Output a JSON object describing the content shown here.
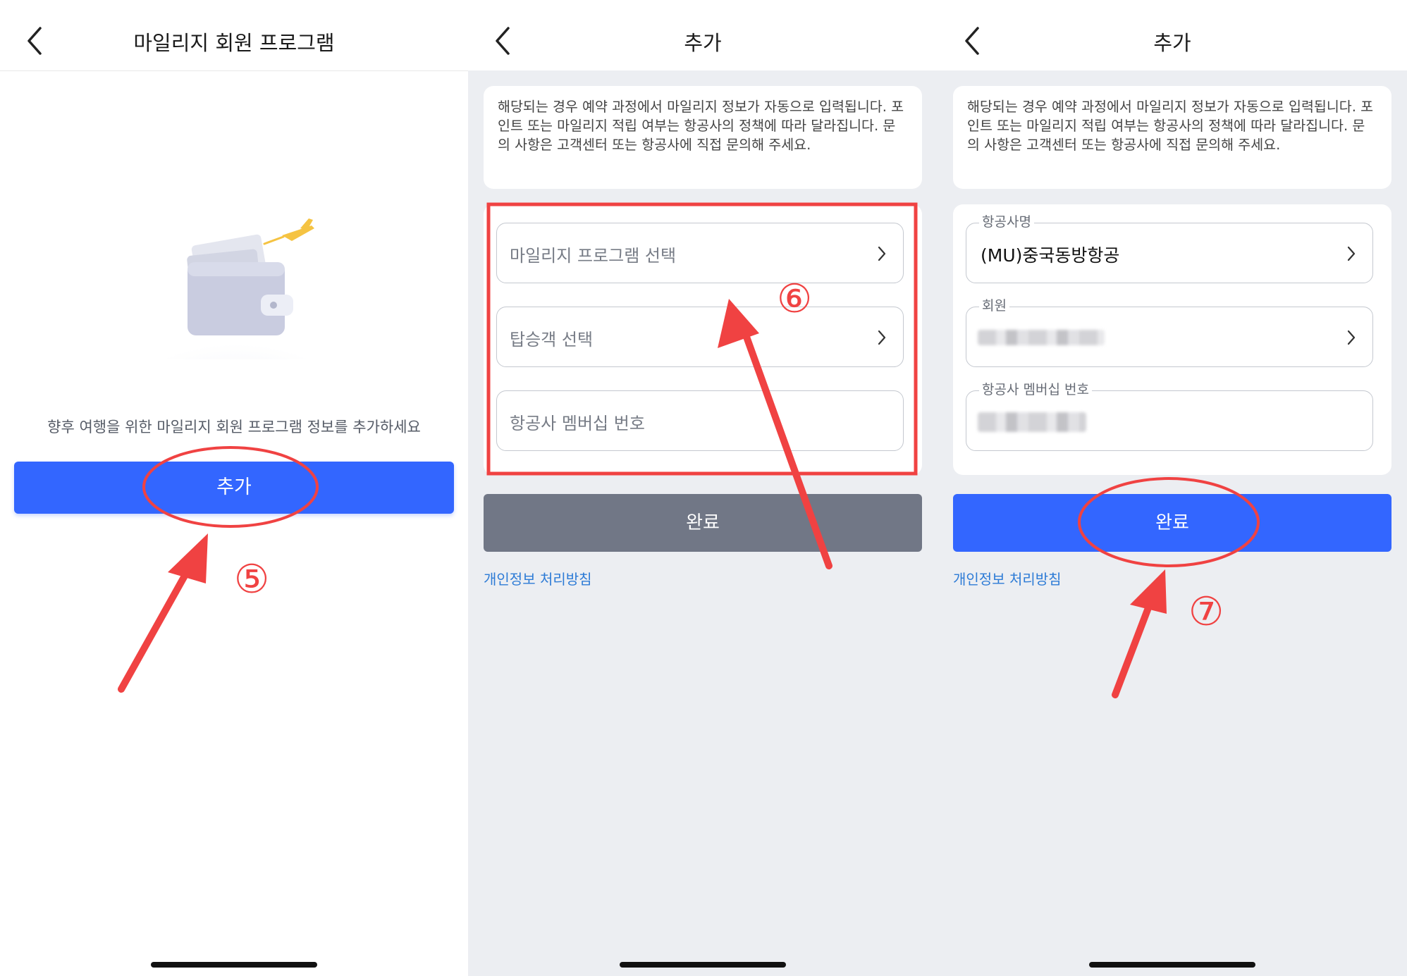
{
  "panel1": {
    "title": "마일리지 회원 프로그램",
    "empty_text": "향후 여행을 위한 마일리지 회원 프로그램 정보를 추가하세요",
    "add_button": "추가"
  },
  "panel2": {
    "title": "추가",
    "notice": "해당되는 경우 예약 과정에서 마일리지 정보가 자동으로 입력됩니다. 포인트 또는 마일리지 적립 여부는 항공사의 정책에 따라 달라집니다. 문의 사항은 고객센터 또는 항공사에 직접 문의해 주세요.",
    "fields": {
      "program_placeholder": "마일리지 프로그램 선택",
      "passenger_placeholder": "탑승객 선택",
      "membership_placeholder": "항공사 멤버십 번호"
    },
    "done_button": "완료",
    "privacy_link": "개인정보 처리방침"
  },
  "panel3": {
    "title": "추가",
    "notice": "해당되는 경우 예약 과정에서 마일리지 정보가 자동으로 입력됩니다. 포인트 또는 마일리지 적립 여부는 항공사의 정책에 따라 달라집니다. 문의 사항은 고객센터 또는 항공사에 직접 문의해 주세요.",
    "fields": {
      "airline_label": "항공사명",
      "airline_value": "(MU)중국동방항공",
      "member_label": "회원",
      "membership_label": "항공사 멤버십 번호"
    },
    "done_button": "완료",
    "privacy_link": "개인정보 처리방침"
  },
  "annotations": {
    "step5": "⑤",
    "step6": "⑥",
    "step7": "⑦",
    "color": "#f04242"
  },
  "icons": {
    "back": "back-chevron-icon",
    "chevron": "chevron-right-icon",
    "illustration": "wallet-airplane-illustration"
  },
  "colors": {
    "primary": "#3366ff",
    "disabled_button": "#717786",
    "link": "#2d7bd6",
    "page_gray": "#eceef2"
  }
}
